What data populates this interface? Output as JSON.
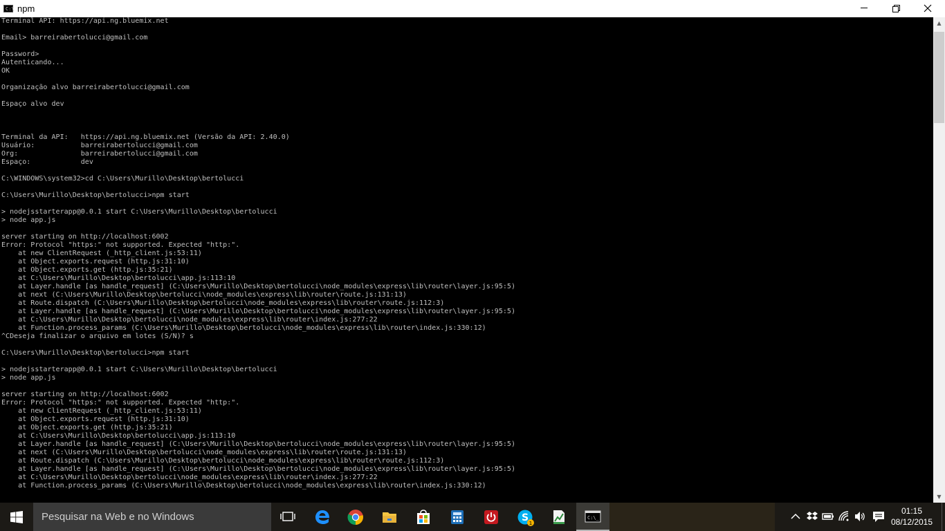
{
  "window": {
    "title": "npm",
    "icon": "cmd-icon",
    "icon_glyph": "C:\\"
  },
  "console": {
    "lines": [
      "Terminal API: https://api.ng.bluemix.net",
      "",
      "Email> barreirabertolucci@gmail.com",
      "",
      "Password>",
      "Autenticando...",
      "OK",
      "",
      "Organização alvo barreirabertolucci@gmail.com",
      "",
      "Espaço alvo dev",
      "",
      "",
      "",
      "Terminal da API:   https://api.ng.bluemix.net (Versão da API: 2.40.0)",
      "Usuário:           barreirabertolucci@gmail.com",
      "Org:               barreirabertolucci@gmail.com",
      "Espaço:            dev",
      "",
      "C:\\WINDOWS\\system32>cd C:\\Users\\Murillo\\Desktop\\bertolucci",
      "",
      "C:\\Users\\Murillo\\Desktop\\bertolucci>npm start",
      "",
      "> nodejsstarterapp@0.0.1 start C:\\Users\\Murillo\\Desktop\\bertolucci",
      "> node app.js",
      "",
      "server starting on http://localhost:6002",
      "Error: Protocol \"https:\" not supported. Expected \"http:\".",
      "    at new ClientRequest (_http_client.js:53:11)",
      "    at Object.exports.request (http.js:31:10)",
      "    at Object.exports.get (http.js:35:21)",
      "    at C:\\Users\\Murillo\\Desktop\\bertolucci\\app.js:113:10",
      "    at Layer.handle [as handle_request] (C:\\Users\\Murillo\\Desktop\\bertolucci\\node_modules\\express\\lib\\router\\layer.js:95:5)",
      "    at next (C:\\Users\\Murillo\\Desktop\\bertolucci\\node_modules\\express\\lib\\router\\route.js:131:13)",
      "    at Route.dispatch (C:\\Users\\Murillo\\Desktop\\bertolucci\\node_modules\\express\\lib\\router\\route.js:112:3)",
      "    at Layer.handle [as handle_request] (C:\\Users\\Murillo\\Desktop\\bertolucci\\node_modules\\express\\lib\\router\\layer.js:95:5)",
      "    at C:\\Users\\Murillo\\Desktop\\bertolucci\\node_modules\\express\\lib\\router\\index.js:277:22",
      "    at Function.process_params (C:\\Users\\Murillo\\Desktop\\bertolucci\\node_modules\\express\\lib\\router\\index.js:330:12)",
      "^CDeseja finalizar o arquivo em lotes (S/N)? s",
      "",
      "C:\\Users\\Murillo\\Desktop\\bertolucci>npm start",
      "",
      "> nodejsstarterapp@0.0.1 start C:\\Users\\Murillo\\Desktop\\bertolucci",
      "> node app.js",
      "",
      "server starting on http://localhost:6002",
      "Error: Protocol \"https:\" not supported. Expected \"http:\".",
      "    at new ClientRequest (_http_client.js:53:11)",
      "    at Object.exports.request (http.js:31:10)",
      "    at Object.exports.get (http.js:35:21)",
      "    at C:\\Users\\Murillo\\Desktop\\bertolucci\\app.js:113:10",
      "    at Layer.handle [as handle_request] (C:\\Users\\Murillo\\Desktop\\bertolucci\\node_modules\\express\\lib\\router\\layer.js:95:5)",
      "    at next (C:\\Users\\Murillo\\Desktop\\bertolucci\\node_modules\\express\\lib\\router\\route.js:131:13)",
      "    at Route.dispatch (C:\\Users\\Murillo\\Desktop\\bertolucci\\node_modules\\express\\lib\\router\\route.js:112:3)",
      "    at Layer.handle [as handle_request] (C:\\Users\\Murillo\\Desktop\\bertolucci\\node_modules\\express\\lib\\router\\layer.js:95:5)",
      "    at C:\\Users\\Murillo\\Desktop\\bertolucci\\node_modules\\express\\lib\\router\\index.js:277:22",
      "    at Function.process_params (C:\\Users\\Murillo\\Desktop\\bertolucci\\node_modules\\express\\lib\\router\\index.js:330:12)"
    ]
  },
  "taskbar": {
    "search_placeholder": "Pesquisar na Web e no Windows",
    "apps": [
      {
        "name": "task-view-icon",
        "active": false
      },
      {
        "name": "edge-icon",
        "active": false
      },
      {
        "name": "chrome-icon",
        "active": false
      },
      {
        "name": "file-explorer-icon",
        "active": false
      },
      {
        "name": "store-icon",
        "active": false
      },
      {
        "name": "calculator-app-icon",
        "active": false
      },
      {
        "name": "power-app-icon",
        "active": false
      },
      {
        "name": "skype-icon",
        "active": false
      },
      {
        "name": "notepad-chart-icon",
        "active": false
      },
      {
        "name": "cmd-icon",
        "active": true
      }
    ],
    "skype_badge": "1",
    "clock": {
      "time": "01:15",
      "date": "08/12/2015"
    }
  },
  "colors": {
    "console_bg": "#000000",
    "console_text": "#c0c0c0",
    "taskbar_bg": "#1c1a16",
    "edge_blue": "#1e90ff",
    "power_red": "#c4191f",
    "skype_blue": "#00aff0"
  }
}
